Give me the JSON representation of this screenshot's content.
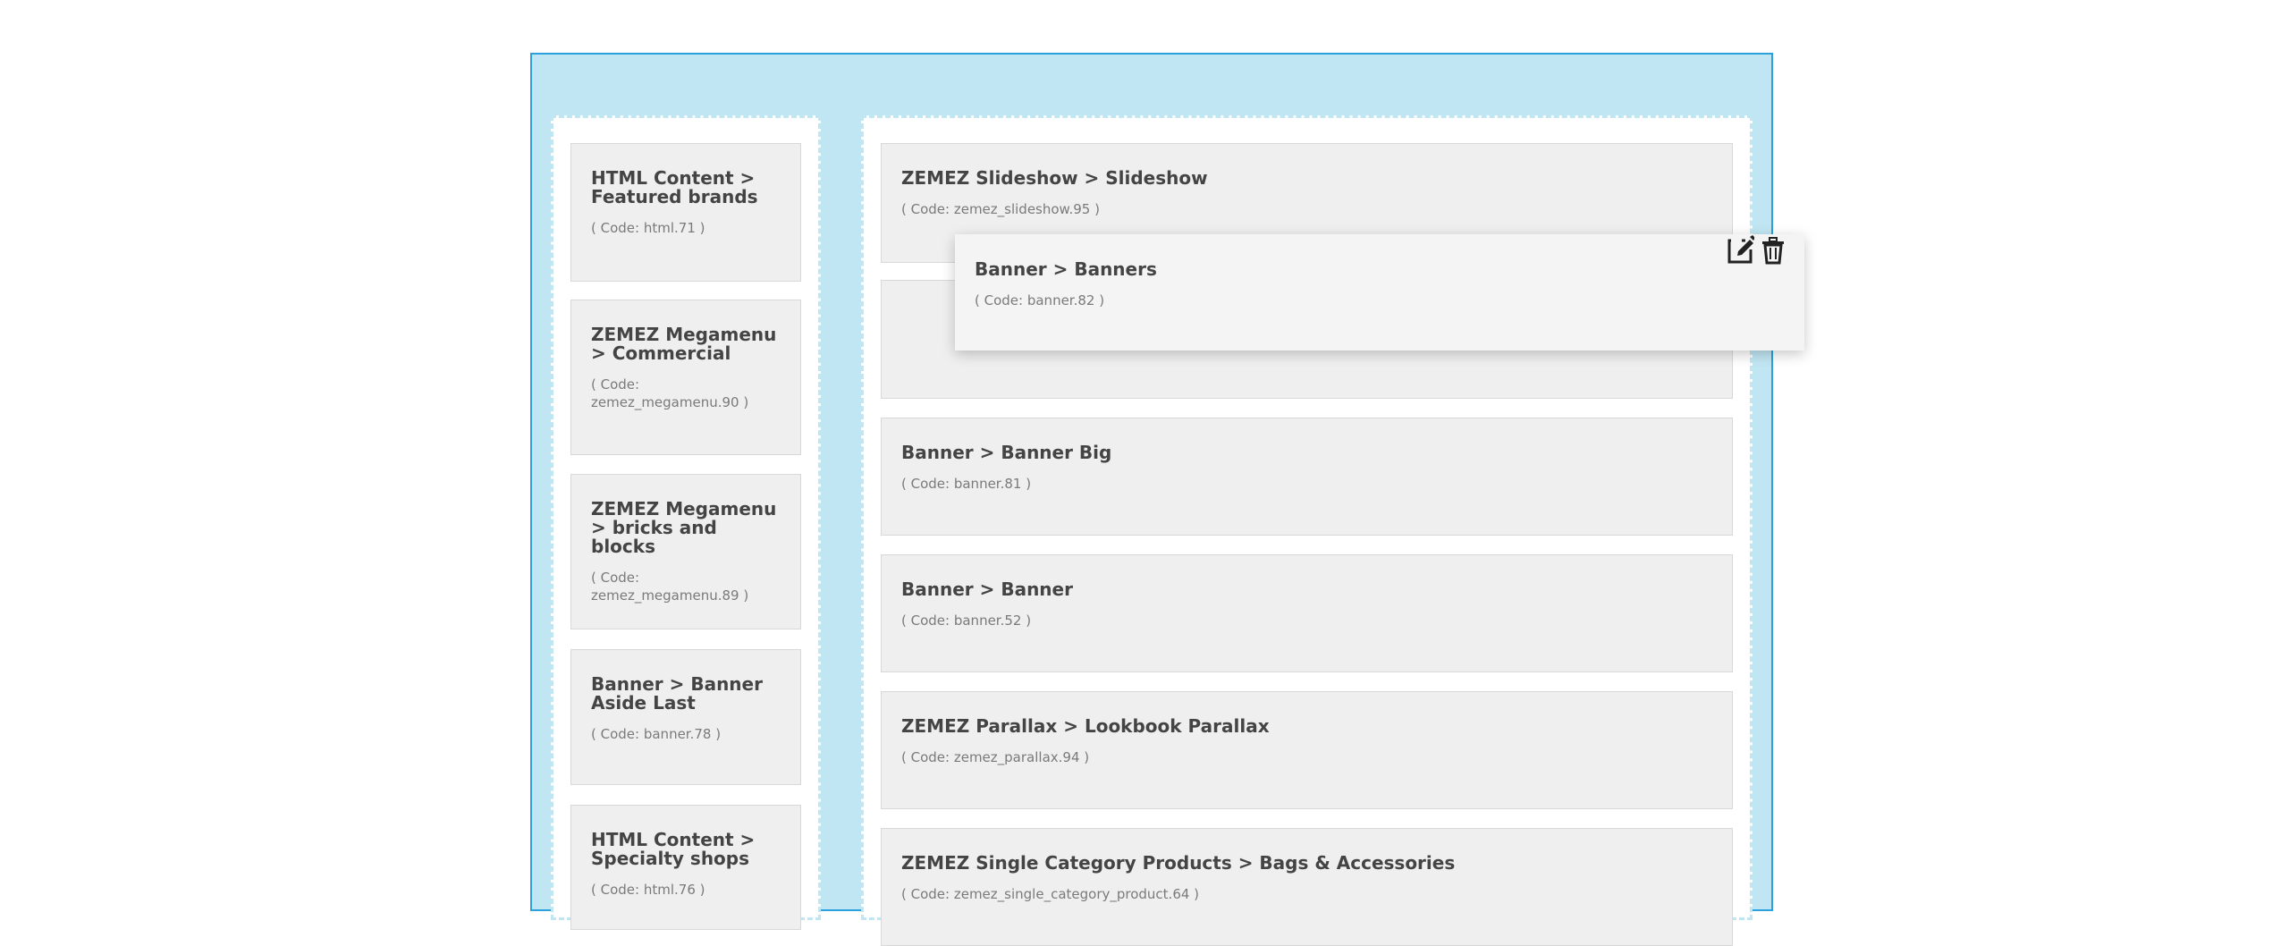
{
  "left_column": {
    "modules": [
      {
        "title": "HTML Content > Featured brands",
        "code": "( Code: html.71 )"
      },
      {
        "title": "ZEMEZ Megamenu > Commercial",
        "code": "( Code: zemez_megamenu.90 )"
      },
      {
        "title": "ZEMEZ Megamenu > bricks and blocks",
        "code": "( Code: zemez_megamenu.89 )"
      },
      {
        "title": "Banner > Banner Aside Last",
        "code": "( Code: banner.78 )"
      },
      {
        "title": "HTML Content > Specialty shops",
        "code": "( Code: html.76 )"
      }
    ]
  },
  "main_column": {
    "modules": [
      {
        "title": "ZEMEZ Slideshow > Slideshow",
        "code": "( Code: zemez_slideshow.95 )"
      },
      {
        "title": "",
        "code": ""
      },
      {
        "title": "Banner > Banner Big",
        "code": "( Code: banner.81 )"
      },
      {
        "title": "Banner > Banner",
        "code": "( Code: banner.52 )"
      },
      {
        "title": "ZEMEZ Parallax > Lookbook Parallax",
        "code": "( Code: zemez_parallax.94 )"
      },
      {
        "title": "ZEMEZ Single Category Products > Bags & Accessories",
        "code": "( Code: zemez_single_category_product.64 )"
      }
    ]
  },
  "dragging_module": {
    "title": "Banner > Banners",
    "code": "( Code: banner.82 )",
    "actions": [
      {
        "icon": "edit-icon"
      },
      {
        "icon": "trash-icon"
      }
    ]
  }
}
